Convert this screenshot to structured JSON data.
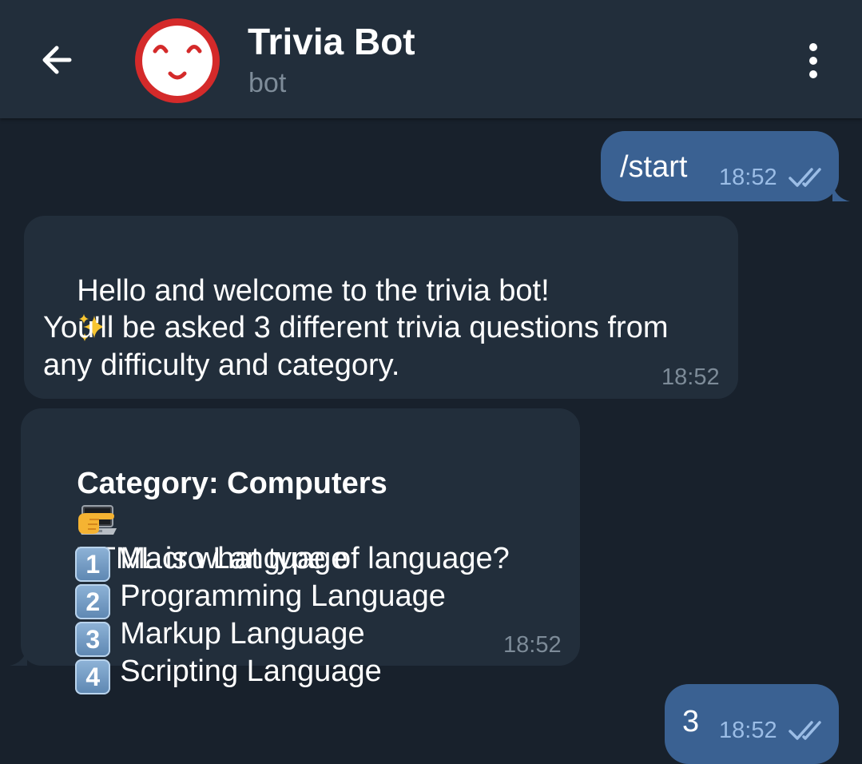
{
  "header": {
    "title": "Trivia Bot",
    "subtitle": "bot",
    "avatar_icon": "smiling-face-icon",
    "accent": "#d42a2a"
  },
  "messages": [
    {
      "direction": "outgoing",
      "text": "/start",
      "time": "18:52",
      "status": "read"
    },
    {
      "direction": "incoming",
      "line1": "Hello and welcome to the trivia bot!",
      "line1_emoji": "sparkles-icon",
      "line2": "You'll be asked 3 different trivia questions from",
      "line3": "any difficulty and category.",
      "time": "18:52"
    },
    {
      "direction": "incoming",
      "category": "Category: Computers",
      "category_emoji": "laptop-icon",
      "question_emoji": "pointing-hand-icon",
      "question": "HTML is what type of language?",
      "options": [
        {
          "key": "1",
          "label": "Macro Language"
        },
        {
          "key": "2",
          "label": "Programming Language"
        },
        {
          "key": "3",
          "label": "Markup Language"
        },
        {
          "key": "4",
          "label": "Scripting Language"
        }
      ],
      "time": "18:52"
    },
    {
      "direction": "outgoing",
      "text": "3",
      "time": "18:52",
      "status": "read"
    }
  ],
  "colors": {
    "background": "#18212c",
    "header": "#222e3b",
    "incoming_bubble": "#222e3b",
    "outgoing_bubble": "#3a6192",
    "secondary_text": "#7e8c99"
  }
}
